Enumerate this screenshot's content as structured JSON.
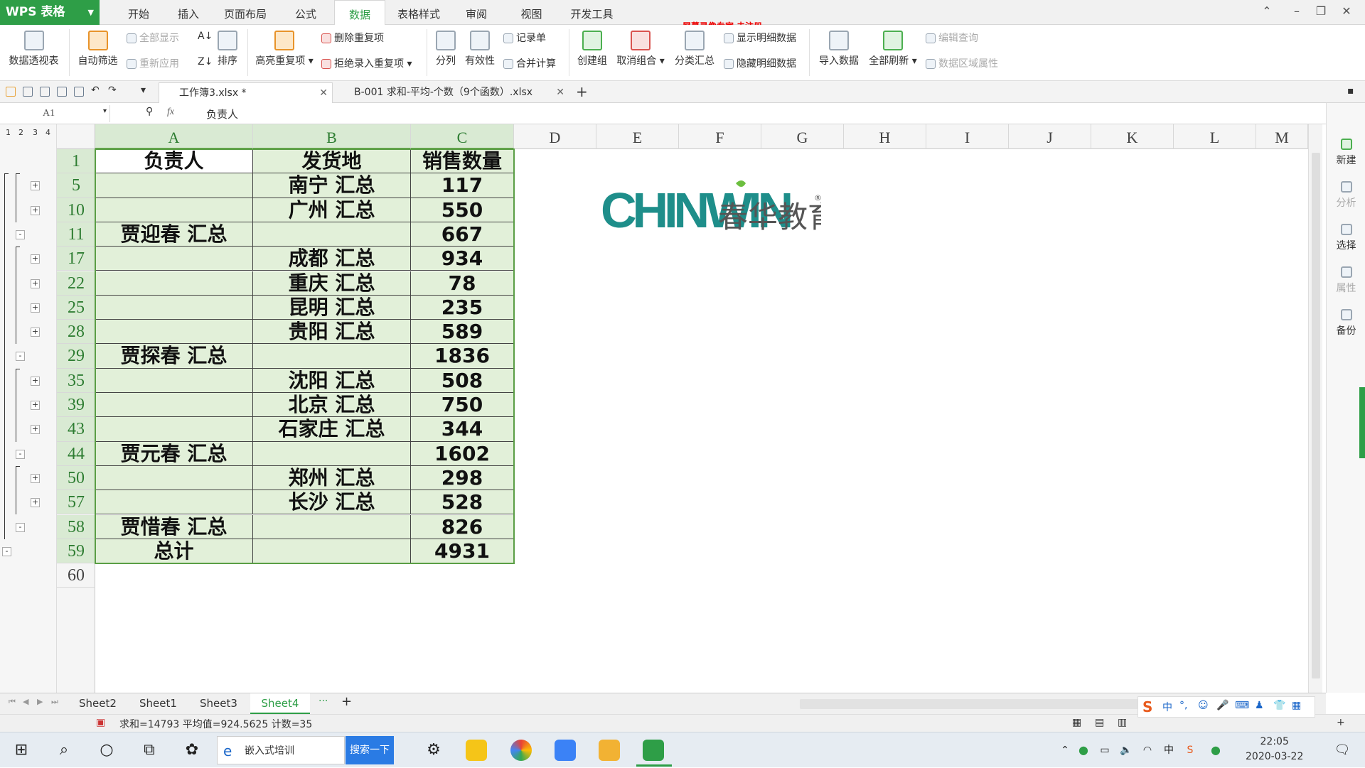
{
  "app": {
    "title": "WPS 表格"
  },
  "menu_tabs": [
    "开始",
    "插入",
    "页面布局",
    "公式",
    "数据",
    "表格样式",
    "审阅",
    "视图",
    "开发工具"
  ],
  "active_menu": "数据",
  "watermark": "屏幕录像专家  未注册",
  "ribbon": {
    "pivot": "数据透视表",
    "autofilter": "自动筛选",
    "show_all": "全部显示",
    "reapply": "重新应用",
    "sort": "排序",
    "highlight_dup": "高亮重复项",
    "remove_dup": "删除重复项",
    "reject_dup": "拒绝录入重复项",
    "split": "分列",
    "validity": "有效性",
    "record": "记录单",
    "consolidate": "合并计算",
    "group": "创建组",
    "ungroup": "取消组合",
    "subtotal": "分类汇总",
    "show_detail": "显示明细数据",
    "hide_detail": "隐藏明细数据",
    "import": "导入数据",
    "refresh_all": "全部刷新",
    "edit_query": "编辑查询",
    "range_props": "数据区域属性"
  },
  "doc_tabs": [
    {
      "label": "工作簿3.xlsx *",
      "active": true
    },
    {
      "label": "B-001 求和-平均-个数（9个函数）.xlsx",
      "active": false
    }
  ],
  "formula_bar": {
    "name_box": "A1",
    "fx": "fx",
    "value": "负责人"
  },
  "outline_levels": [
    "1",
    "2",
    "3",
    "4"
  ],
  "columns": [
    "A",
    "B",
    "C",
    "D",
    "E",
    "F",
    "G",
    "H",
    "I",
    "J",
    "K",
    "L",
    "M"
  ],
  "rows": [
    {
      "num": "1",
      "a": "负责人",
      "b": "发货地",
      "c": "销售数量"
    },
    {
      "num": "5",
      "a": "",
      "b": "南宁 汇总",
      "c": "117"
    },
    {
      "num": "10",
      "a": "",
      "b": "广州 汇总",
      "c": "550"
    },
    {
      "num": "11",
      "a": "贾迎春 汇总",
      "b": "",
      "c": "667"
    },
    {
      "num": "17",
      "a": "",
      "b": "成都 汇总",
      "c": "934"
    },
    {
      "num": "22",
      "a": "",
      "b": "重庆 汇总",
      "c": "78"
    },
    {
      "num": "25",
      "a": "",
      "b": "昆明 汇总",
      "c": "235"
    },
    {
      "num": "28",
      "a": "",
      "b": "贵阳 汇总",
      "c": "589"
    },
    {
      "num": "29",
      "a": "贾探春 汇总",
      "b": "",
      "c": "1836"
    },
    {
      "num": "35",
      "a": "",
      "b": "沈阳 汇总",
      "c": "508"
    },
    {
      "num": "39",
      "a": "",
      "b": "北京 汇总",
      "c": "750"
    },
    {
      "num": "43",
      "a": "",
      "b": "石家庄 汇总",
      "c": "344"
    },
    {
      "num": "44",
      "a": "贾元春 汇总",
      "b": "",
      "c": "1602"
    },
    {
      "num": "50",
      "a": "",
      "b": "郑州 汇总",
      "c": "298"
    },
    {
      "num": "57",
      "a": "",
      "b": "长沙 汇总",
      "c": "528"
    },
    {
      "num": "58",
      "a": "贾惜春 汇总",
      "b": "",
      "c": "826"
    },
    {
      "num": "59",
      "a": "总计",
      "b": "",
      "c": "4931"
    },
    {
      "num": "60",
      "a": "",
      "b": "",
      "c": ""
    }
  ],
  "logo": {
    "brand": "CHINWIN",
    "cn": "春华教育"
  },
  "right_pane": [
    "新建",
    "分析",
    "选择",
    "属性",
    "备份"
  ],
  "sheets": [
    "Sheet2",
    "Sheet1",
    "Sheet3",
    "Sheet4"
  ],
  "active_sheet": "Sheet4",
  "status": "求和=14793  平均值=924.5625  计数=35",
  "taskbar": {
    "app_label": "嵌入式培训",
    "search_btn": "搜索一下",
    "time": "22:05",
    "date": "2020-03-22"
  },
  "colors": {
    "wps_green": "#2e9e47",
    "cell_fill": "#e2f0d9",
    "selection": "#5a9e45"
  }
}
